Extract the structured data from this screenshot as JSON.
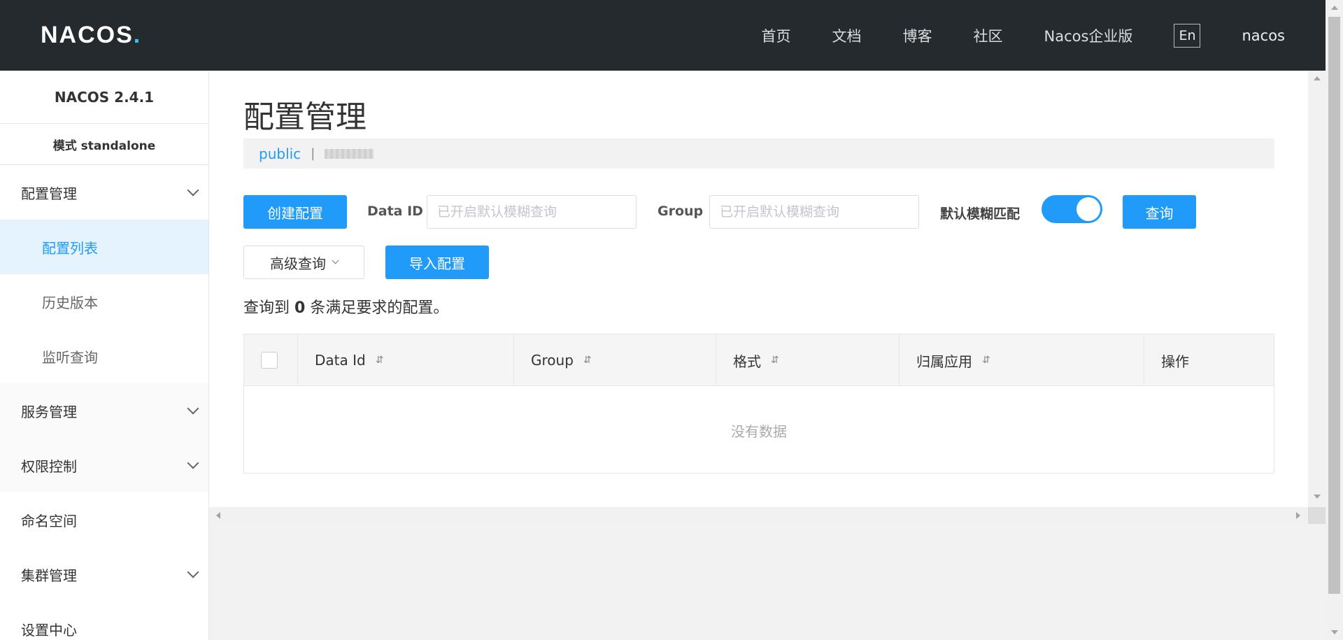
{
  "header": {
    "logo_main": "NACOS",
    "logo_dot": ".",
    "nav": [
      "首页",
      "文档",
      "博客",
      "社区",
      "Nacos企业版"
    ],
    "lang": "En",
    "user": "nacos"
  },
  "sidebar": {
    "version": "NACOS 2.4.1",
    "mode": "模式 standalone",
    "items": {
      "config": "配置管理",
      "config_list": "配置列表",
      "history": "历史版本",
      "listen": "监听查询",
      "service": "服务管理",
      "auth": "权限控制",
      "namespace": "命名空间",
      "cluster": "集群管理",
      "settings": "设置中心"
    }
  },
  "main": {
    "title": "配置管理",
    "namespace": "public",
    "separator": "|",
    "create_button": "创建配置",
    "dataid_label": "Data ID",
    "dataid_placeholder": "已开启默认模糊查询",
    "group_label": "Group",
    "group_placeholder": "已开启默认模糊查询",
    "fuzzy_label": "默认模糊匹配",
    "fuzzy_on": true,
    "query_button": "查询",
    "advanced_button": "高级查询",
    "import_button": "导入配置",
    "result_prefix": "查询到",
    "result_count": "0",
    "result_suffix": "条满足要求的配置。",
    "table": {
      "columns": [
        "Data Id",
        "Group",
        "格式",
        "归属应用",
        "操作"
      ],
      "sort_glyph": "⇵",
      "empty_text": "没有数据"
    }
  },
  "colors": {
    "primary": "#209bfa",
    "topbar": "#252a2f",
    "active_bg": "#e5f3fe"
  }
}
